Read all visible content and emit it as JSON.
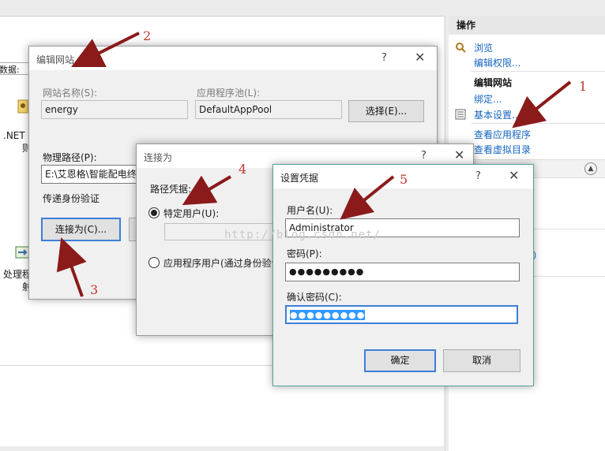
{
  "actions_panel": {
    "header": "操作",
    "browse": "浏览",
    "edit_permissions": "编辑权限...",
    "section_edit_site": "编辑网站",
    "bindings": "绑定...",
    "basic_settings": "基本设置...",
    "view_apps": "查看应用程序",
    "view_vdirs": "查看虚拟目录",
    "partial_p": "p)"
  },
  "background": {
    "left_label": "数据:",
    "net_label": ".NET 授",
    "net_label2": "则",
    "handler_label": "处理程",
    "handler_label2": "射"
  },
  "edit_site_dialog": {
    "title": "编辑网站",
    "site_name_label": "网站名称(S):",
    "site_name_value": "energy",
    "app_pool_label": "应用程序池(L):",
    "app_pool_value": "DefaultAppPool",
    "select_button": "选择(E)...",
    "physical_path_label": "物理路径(P):",
    "physical_path_value": "E:\\艾恩格\\智能配电终端",
    "pass_through_label": "传递身份验证",
    "connect_as_button": "连接为(C)..."
  },
  "connect_as_dialog": {
    "title": "连接为",
    "path_credentials_label": "路径凭据:",
    "specific_user_label": "特定用户(U):",
    "app_user_label": "应用程序用户(通过身份验证"
  },
  "set_credentials_dialog": {
    "title": "设置凭据",
    "username_label": "用户名(U):",
    "username_value": "Administrator",
    "password_label": "密码(P):",
    "password_value": "●●●●●●●●●",
    "confirm_label": "确认密码(C):",
    "confirm_value": "●●●●●●●●●",
    "ok_button": "确定",
    "cancel_button": "取消"
  },
  "annotations": [
    "1",
    "2",
    "3",
    "4",
    "5"
  ],
  "watermark": "http://blog.csdn.net/",
  "colors": {
    "annotation": "#c0392b",
    "link": "#1565c0",
    "focus": "#3c7fd8",
    "dialog_border": "#5aa09a"
  }
}
